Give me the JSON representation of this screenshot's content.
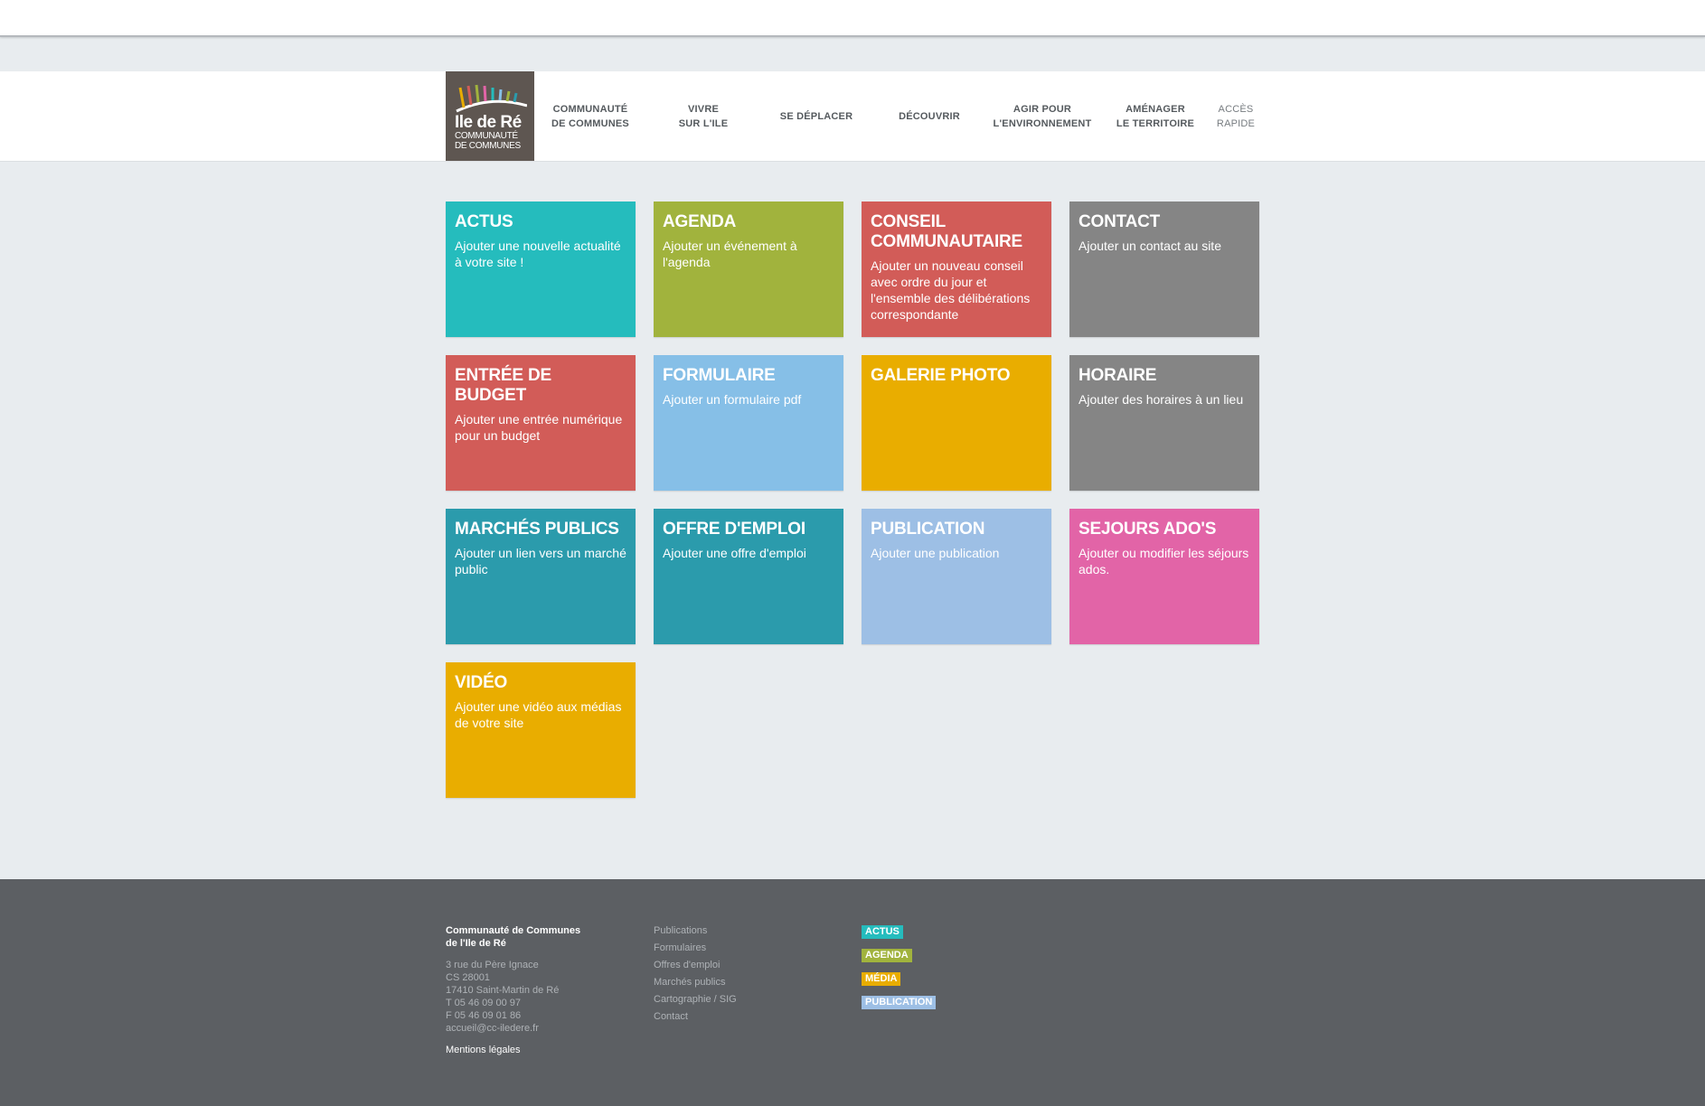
{
  "logo": {
    "name": "Ile de Ré",
    "sub_line1": "COMMUNAUTÉ",
    "sub_line2": "DE COMMUNES"
  },
  "nav": [
    {
      "line1": "COMMUNAUTÉ",
      "line2": "DE COMMUNES"
    },
    {
      "line1": "VIVRE",
      "line2": "SUR L'ILE"
    },
    {
      "line1": "SE DÉPLACER",
      "line2": ""
    },
    {
      "line1": "DÉCOUVRIR",
      "line2": ""
    },
    {
      "line1": "AGIR POUR",
      "line2": "L'ENVIRONNEMENT"
    },
    {
      "line1": "AMÉNAGER",
      "line2": "LE TERRITOIRE"
    },
    {
      "line1": "ACCÈS",
      "line2": "RAPIDE"
    }
  ],
  "tiles": [
    {
      "title": "ACTUS",
      "desc": "Ajouter une nouvelle actualité à votre site !",
      "color": "#25bcbd"
    },
    {
      "title": "AGENDA",
      "desc": "Ajouter un événement à l'agenda",
      "color": "#a1b33d"
    },
    {
      "title": "CONSEIL COMMUNAUTAIRE",
      "desc": "Ajouter un nouveau conseil avec ordre du jour et l'ensemble des délibérations correspondante",
      "color": "#d25c58"
    },
    {
      "title": "CONTACT",
      "desc": "Ajouter un contact au site",
      "color": "#858585"
    },
    {
      "title": "ENTRÉE DE BUDGET",
      "desc": "Ajouter une entrée numérique pour un budget",
      "color": "#d25c58"
    },
    {
      "title": "FORMULAIRE",
      "desc": "Ajouter un formulaire pdf",
      "color": "#86bfe7"
    },
    {
      "title": "GALERIE PHOTO",
      "desc": "",
      "color": "#e9ad00"
    },
    {
      "title": "HORAIRE",
      "desc": "Ajouter des horaires à un lieu",
      "color": "#858585"
    },
    {
      "title": "MARCHÉS PUBLICS",
      "desc": "Ajouter un lien vers un marché public",
      "color": "#2b9bac"
    },
    {
      "title": "OFFRE D'EMPLOI",
      "desc": "Ajouter une offre d'emploi",
      "color": "#2b9bac"
    },
    {
      "title": "PUBLICATION",
      "desc": "Ajouter une publication",
      "color": "#9dbfe5"
    },
    {
      "title": "SEJOURS ADO'S",
      "desc": "Ajouter ou modifier les séjours ados.",
      "color": "#e264a7"
    },
    {
      "title": "VIDÉO",
      "desc": "Ajouter une vidéo aux médias de votre site",
      "color": "#e9ad00"
    }
  ],
  "footer": {
    "org_line1": "Communauté de Communes",
    "org_line2": "de l'Ile de Ré",
    "address": [
      "3 rue du Père Ignace",
      "CS 28001",
      "17410 Saint-Martin de Ré",
      "T 05 46 09 00 97",
      "F 05 46 09 01 86",
      "accueil@cc-iledere.fr"
    ],
    "mentions": "Mentions légales",
    "links": [
      "Publications",
      "Formulaires",
      "Offres d'emploi",
      "Marchés publics",
      "Cartographie / SIG",
      "Contact"
    ],
    "badges": [
      {
        "label": "ACTUS",
        "color": "#25bcbd"
      },
      {
        "label": "AGENDA",
        "color": "#a1b33d"
      },
      {
        "label": "MÉDIA",
        "color": "#e9ad00"
      },
      {
        "label": "PUBLICATION",
        "color": "#9dbfe5"
      }
    ]
  }
}
